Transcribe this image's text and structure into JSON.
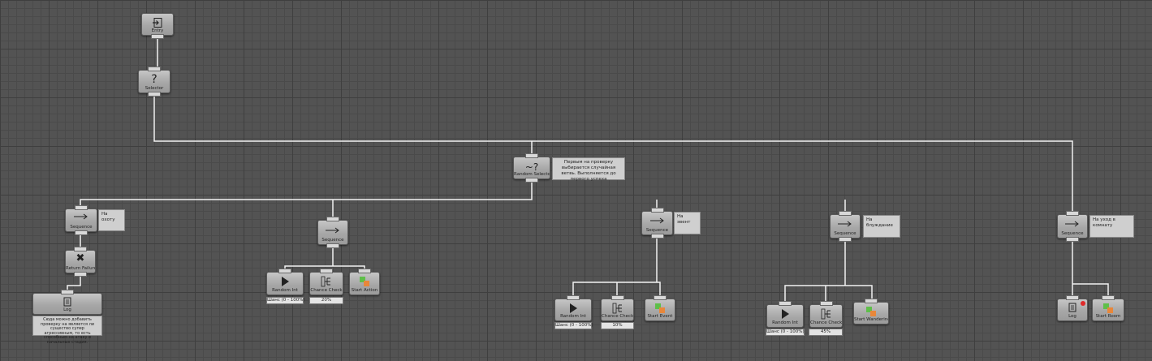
{
  "nodes": {
    "entry": {
      "label": "Entry",
      "icon": "entry-icon"
    },
    "selector": {
      "label": "Selector",
      "icon": "question-icon",
      "glyph": "?"
    },
    "random_selector": {
      "label": "Random Selector",
      "icon": "random-selector-icon",
      "glyph": "~?",
      "comment": "Первым на проверку выбирается случайная ветвь. Выполняется до первого успеха"
    },
    "seq_hunt": {
      "label": "Sequence",
      "icon": "sequence-arrow-icon",
      "comment": "На охоту"
    },
    "return_failure": {
      "label": "Return Failure",
      "icon": "x-icon"
    },
    "log_1": {
      "label": "Log",
      "icon": "log-icon",
      "comment": "Сюда можно добавить проверку на является ли существо супер агрессивным, то есть способным на атаку в начальных стадия."
    },
    "seq_action": {
      "label": "Sequence",
      "icon": "sequence-arrow-icon"
    },
    "random_int_1": {
      "label": "Random Int",
      "icon": "play-icon",
      "param": "Шанс (0 - 100%)"
    },
    "chance_check_1": {
      "label": "Chance Check",
      "icon": "chance-icon",
      "param": "20%"
    },
    "start_action": {
      "label": "Start Action",
      "icon": "start-icon"
    },
    "seq_event": {
      "label": "Sequence",
      "icon": "sequence-arrow-icon",
      "comment": "На эвент"
    },
    "random_int_2": {
      "label": "Random Int",
      "icon": "play-icon",
      "param": "Шанс (0 - 100%)"
    },
    "chance_check_2": {
      "label": "Chance Check",
      "icon": "chance-icon",
      "param": "10%"
    },
    "start_event": {
      "label": "Start Event",
      "icon": "start-icon"
    },
    "seq_wander": {
      "label": "Sequence",
      "icon": "sequence-arrow-icon",
      "comment": "На блуждание"
    },
    "random_int_3": {
      "label": "Random Int",
      "icon": "play-icon",
      "param": "Шанс (0 - 100%)"
    },
    "chance_check_3": {
      "label": "Chance Check",
      "icon": "chance-icon",
      "param": "45%"
    },
    "start_wandering": {
      "label": "Start Wandering",
      "icon": "start-icon"
    },
    "seq_room": {
      "label": "Sequence",
      "icon": "sequence-arrow-icon",
      "comment": "На уход в комнату"
    },
    "log_2": {
      "label": "Log",
      "icon": "log-icon",
      "badge_color": "#e02a2a"
    },
    "start_room": {
      "label": "Start Room",
      "icon": "start-icon"
    }
  },
  "colors": {
    "canvas": "#535353",
    "wire": "#f2f2f2",
    "node": "#b0b0b0",
    "start_green": "#5fbf4a",
    "start_orange": "#e8873a"
  }
}
